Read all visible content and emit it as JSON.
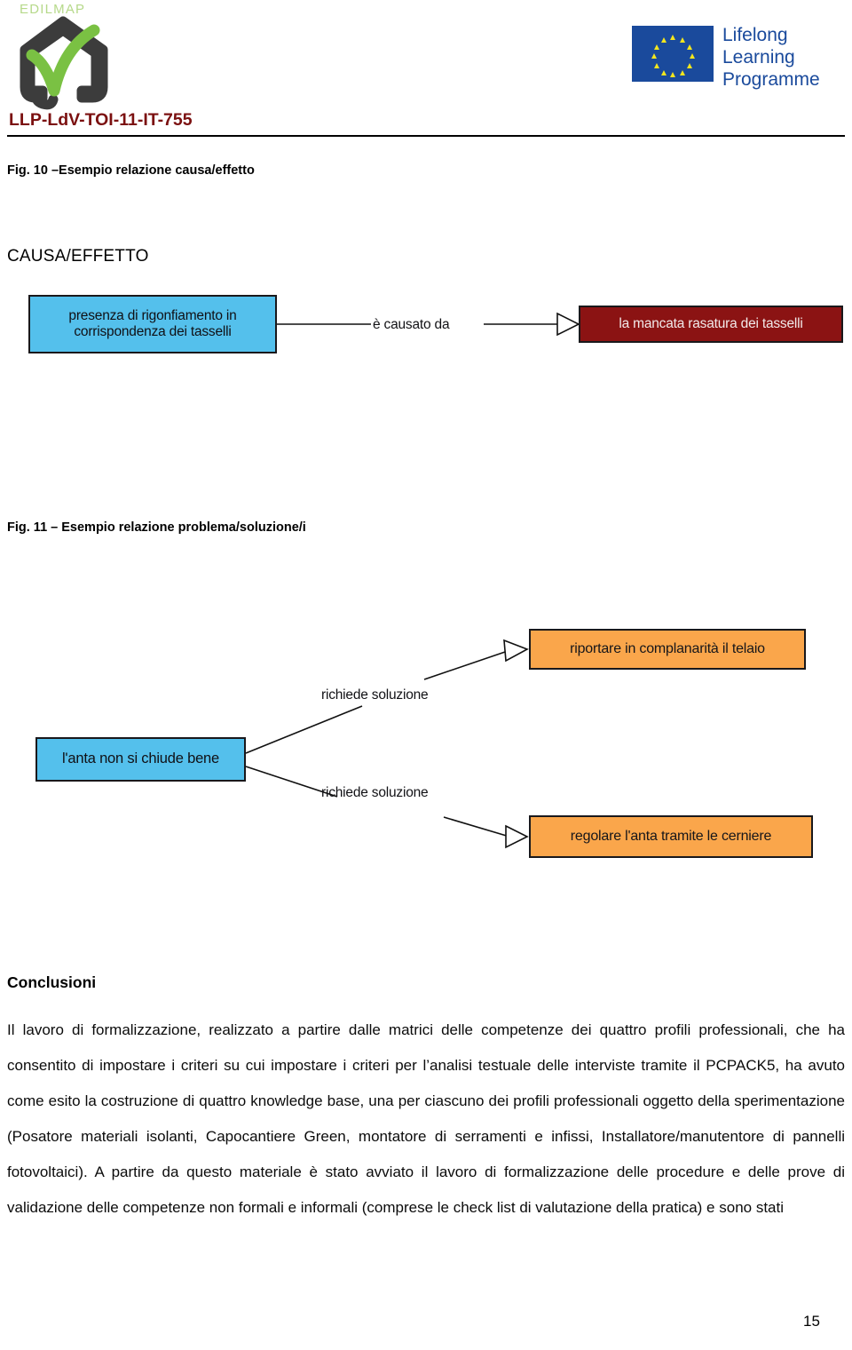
{
  "header": {
    "brand_wordmark": "EDILMAP",
    "brand_logo_icon": "edilmap-house-check-logo",
    "project_code": "LLP-LdV-TOI-11-IT-755",
    "llp": {
      "flag_icon": "eu-flag-icon",
      "text": "Lifelong\nLearning\nProgramme",
      "flag_color": "#1a4a9c",
      "star_color": "#f4e61e",
      "text_color": "#1a4a9c"
    },
    "project_code_color": "#7b1010"
  },
  "figures": [
    {
      "caption": "Fig. 10 –Esempio relazione causa/effetto",
      "section_title": "CAUSA/EFFETTO",
      "type": "cause-effect",
      "nodes": [
        {
          "id": "cause-source",
          "label": "presenza di rigonfiamento in corrispondenza dei tasselli",
          "color": "#54c0ec",
          "role": "problem"
        },
        {
          "id": "cause-target",
          "label": "la mancata rasatura dei tasselli",
          "color": "#8b1313",
          "role": "cause"
        }
      ],
      "edges": [
        {
          "label": "è causato da",
          "from": "cause-source",
          "to": "cause-target"
        }
      ]
    },
    {
      "caption": "Fig. 11 – Esempio relazione problema/soluzione/i",
      "type": "problem-solution",
      "nodes": [
        {
          "id": "problem",
          "label": "l'anta non si chiude bene",
          "color": "#54c0ec",
          "role": "problem"
        },
        {
          "id": "solution-1",
          "label": "riportare in complanarità il telaio",
          "color": "#faa64b",
          "role": "solution"
        },
        {
          "id": "solution-2",
          "label": "regolare l'anta tramite le cerniere",
          "color": "#faa64b",
          "role": "solution"
        }
      ],
      "edges": [
        {
          "label": "richiede soluzione",
          "from": "problem",
          "to": "solution-1"
        },
        {
          "label": "richiede soluzione",
          "from": "problem",
          "to": "solution-2"
        }
      ]
    }
  ],
  "conclusions": {
    "heading": "Conclusioni",
    "body": "Il lavoro di formalizzazione, realizzato a partire dalle matrici delle competenze dei quattro profili professionali, che ha consentito di impostare i criteri su cui impostare i criteri per l’analisi testuale delle interviste tramite il PCPACK5, ha avuto come esito la costruzione di quattro knowledge base, una per ciascuno dei profili professionali oggetto della sperimentazione (Posatore materiali isolanti, Capocantiere Green, montatore di serramenti e infissi, Installatore/manutentore di pannelli fotovoltaici). A partire da questo materiale è stato avviato il lavoro di formalizzazione delle procedure e delle prove di validazione delle competenze non formali e informali (comprese le check list di valutazione della pratica) e sono stati"
  },
  "footer": {
    "page_number": "15"
  }
}
